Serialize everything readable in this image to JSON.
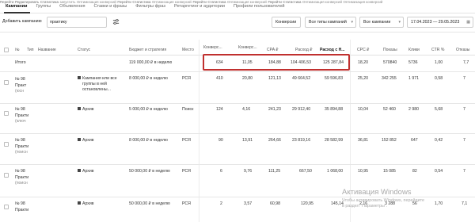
{
  "tabs": [
    "Кампании",
    "Группы",
    "Объявления",
    "Ставки и фразы",
    "Фильтры фраз",
    "Ретаргетинг и аудитории",
    "Профили пользователей"
  ],
  "filter_bar": {
    "add_campaign": "Добавить кампанию",
    "search_value": "практику",
    "goal_dropdown": "Конверсии",
    "campaign_types_dropdown": "Все типы кампаний",
    "campaigns_dropdown": "Все кампании",
    "date_range": "17.04.2023 — 29.05.2023"
  },
  "headers": {
    "num": "№",
    "type": "Тип",
    "name": "Название",
    "status": "Статус",
    "budget": "Бюджет и стратегия",
    "place": "Место",
    "conversions": "Конверс...",
    "conv_rate": "Конверс...",
    "cpa": "CPA ₽",
    "spend": "Расход ₽",
    "spend_with_vat": "Расход с Н...",
    "cpc": "CPC ₽",
    "impressions": "Показы",
    "clicks": "Клики",
    "ctr": "CTR %",
    "refusals": "Отказы"
  },
  "total_row": {
    "label": "Итого",
    "budget": "119 000,00 ₽ в неделю",
    "conversions": "634",
    "conv_rate": "11,05",
    "cpa": "184,88",
    "spend": "104 406,53",
    "spend_with_vat": "125 287,84",
    "cpc": "18,20",
    "impressions": "570840",
    "clicks": "5736",
    "ctr": "1,00",
    "refusals": "7,7"
  },
  "rows": [
    {
      "num": "№ 98",
      "name_lines": [
        "Практ",
        "(юсн"
      ],
      "links": [
        "Перейти",
        "Редактировать",
        "Статистика"
      ],
      "status_lines": [
        "Кампания или все",
        "группы в ней",
        "остановлены..."
      ],
      "status_note": "запустить",
      "budget": "8 000,00 ₽ в неделю",
      "strategy": "Оптимизация конверсий",
      "place": "РСЯ",
      "conversions": "410",
      "conv_rate": "20,80",
      "cpa": "121,13",
      "spend": "49 664,52",
      "spend_with_vat": "59 596,83",
      "cpc": "25,20",
      "impressions": "342 255",
      "clicks": "1 971",
      "ctr": "0,58",
      "refusals": "7"
    },
    {
      "num": "№ 98",
      "name_lines": [
        "Практи",
        "(ключ"
      ],
      "links": [
        "Перейти",
        "Статистика"
      ],
      "status_lines": [
        "Архив"
      ],
      "status_note": "",
      "budget": "5 000,00 ₽ в неделю",
      "strategy": "Оптимизация конверсий",
      "place": "Поиск",
      "conversions": "124",
      "conv_rate": "4,16",
      "cpa": "241,23",
      "spend": "29 912,40",
      "spend_with_vat": "35 894,88",
      "cpc": "10,04",
      "impressions": "52 460",
      "clicks": "2 980",
      "ctr": "5,68",
      "refusals": "7"
    },
    {
      "num": "№ 98",
      "name_lines": [
        "Практи",
        "(поисн"
      ],
      "links": [
        "Перейти",
        "Статистика"
      ],
      "status_lines": [
        "Архив"
      ],
      "status_note": "",
      "budget": "8 000,00 ₽ в неделю",
      "strategy": "Оптимизация конверсий",
      "place": "РСЯ",
      "conversions": "90",
      "conv_rate": "13,91",
      "cpa": "264,66",
      "spend": "23 819,16",
      "spend_with_vat": "28 582,99",
      "cpc": "36,81",
      "impressions": "152 852",
      "clicks": "647",
      "ctr": "0,42",
      "refusals": "7"
    },
    {
      "num": "№ 98",
      "name_lines": [
        "Практи",
        "(поисн"
      ],
      "links": [
        "Перейти",
        "Статистика"
      ],
      "status_lines": [
        "Архив"
      ],
      "status_note": "",
      "budget": "50 000,00 ₽ в неделю",
      "strategy": "Оптимизация конверсий",
      "place": "РСЯ",
      "conversions": "6",
      "conv_rate": "9,76",
      "cpa": "111,25",
      "spend": "667,50",
      "spend_with_vat": "1 068,00",
      "cpc": "10,95",
      "impressions": "15 085",
      "clicks": "82",
      "ctr": "0,54",
      "refusals": "7"
    },
    {
      "num": "№ 98",
      "name_lines": [
        "Практи"
      ],
      "links": [],
      "status_lines": [
        "Архив"
      ],
      "status_note": "",
      "budget": "50 000,00 ₽ в неделю",
      "strategy": "Оптимизация конверсий",
      "place": "РСЯ",
      "conversions": "2",
      "conv_rate": "3,57",
      "cpa": "60,98",
      "spend": "120,95",
      "spend_with_vat": "145,14",
      "cpc": "2,16",
      "impressions": "3 288",
      "clicks": "56",
      "ctr": "1,70",
      "refusals": "7,1"
    }
  ],
  "watermark": {
    "title": "Активация Windows",
    "line1": "Чтобы активировать Windows, перейдите",
    "line2": "в раздел \"Параметры\"."
  },
  "colors": {
    "highlight_border": "#c0302f",
    "active_tab": "#111111"
  }
}
